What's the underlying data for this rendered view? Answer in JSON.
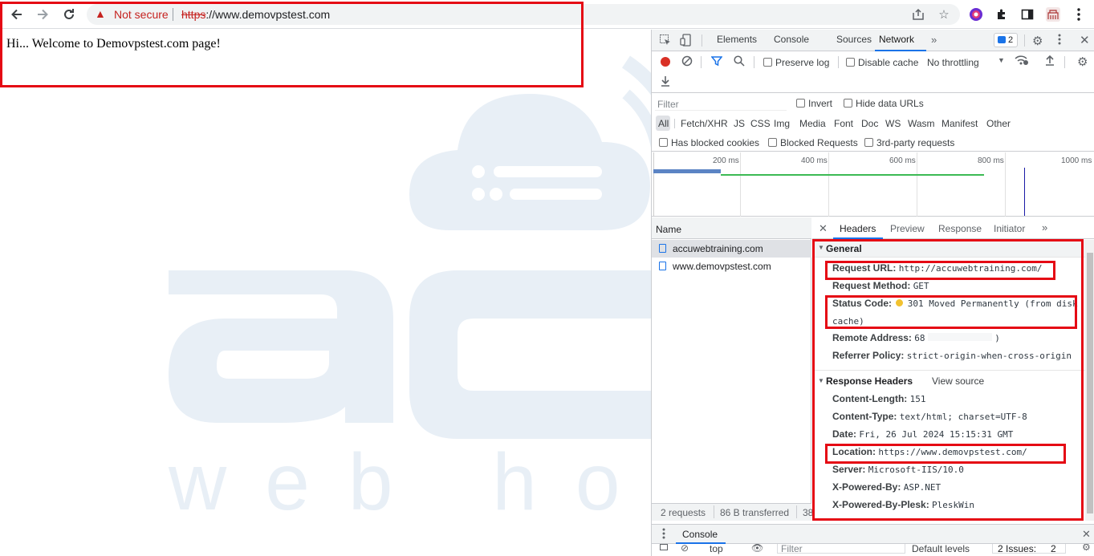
{
  "browser": {
    "security_label": "Not secure",
    "url_scheme": "https",
    "url_rest": "://www.demovpstest.com"
  },
  "page": {
    "welcome_text": "Hi... Welcome to Demovpstest.com page!"
  },
  "devtools": {
    "tabs": [
      "Elements",
      "Console",
      "Sources",
      "Network"
    ],
    "active_tab": "Network",
    "issues_badge": "2",
    "toolbar": {
      "preserve_log": "Preserve log",
      "disable_cache": "Disable cache",
      "throttling": "No throttling"
    },
    "filter": {
      "placeholder": "Filter",
      "invert": "Invert",
      "hide_data_urls": "Hide data URLs",
      "types": [
        "All",
        "Fetch/XHR",
        "JS",
        "CSS",
        "Img",
        "Media",
        "Font",
        "Doc",
        "WS",
        "Wasm",
        "Manifest",
        "Other"
      ],
      "has_blocked_cookies": "Has blocked cookies",
      "blocked_requests": "Blocked Requests",
      "third_party": "3rd-party requests"
    },
    "timeline_ticks": [
      "200 ms",
      "400 ms",
      "600 ms",
      "800 ms",
      "1000 ms"
    ],
    "request_list": {
      "header": "Name",
      "items": [
        "accuwebtraining.com",
        "www.demovpstest.com"
      ],
      "summary_requests": "2 requests",
      "summary_transferred": "86 B transferred",
      "summary_cut": "38"
    },
    "detail_tabs": [
      "Headers",
      "Preview",
      "Response",
      "Initiator"
    ],
    "general": {
      "title": "General",
      "request_url_key": "Request URL:",
      "request_url_val": "http://accuwebtraining.com/",
      "request_method_key": "Request Method:",
      "request_method_val": "GET",
      "status_code_key": "Status Code:",
      "status_code_val": "301 Moved Permanently (from disk",
      "status_code_val2": "cache)",
      "remote_address_key": "Remote Address:",
      "remote_address_val": "68",
      "remote_address_tail": ")",
      "referrer_policy_key": "Referrer Policy:",
      "referrer_policy_val": "strict-origin-when-cross-origin"
    },
    "response_headers": {
      "title": "Response Headers",
      "view_source": "View source",
      "rows": [
        {
          "key": "Content-Length:",
          "val": "151"
        },
        {
          "key": "Content-Type:",
          "val": "text/html; charset=UTF-8"
        },
        {
          "key": "Date:",
          "val": "Fri, 26 Jul 2024 15:15:31 GMT"
        },
        {
          "key": "Location:",
          "val": "https://www.demovpstest.com/"
        },
        {
          "key": "Server:",
          "val": "Microsoft-IIS/10.0"
        },
        {
          "key": "X-Powered-By:",
          "val": "ASP.NET"
        },
        {
          "key": "X-Powered-By-Plesk:",
          "val": "PleskWin"
        }
      ]
    },
    "drawer": {
      "tab": "Console",
      "context": "top",
      "filter_placeholder": "Filter",
      "levels": "Default levels",
      "issues": "2 Issues:",
      "issues_count": "2"
    }
  },
  "colors": {
    "highlight_red": "#e50914",
    "accent_blue": "#1a73e8",
    "status_yellow": "#f2c230"
  }
}
